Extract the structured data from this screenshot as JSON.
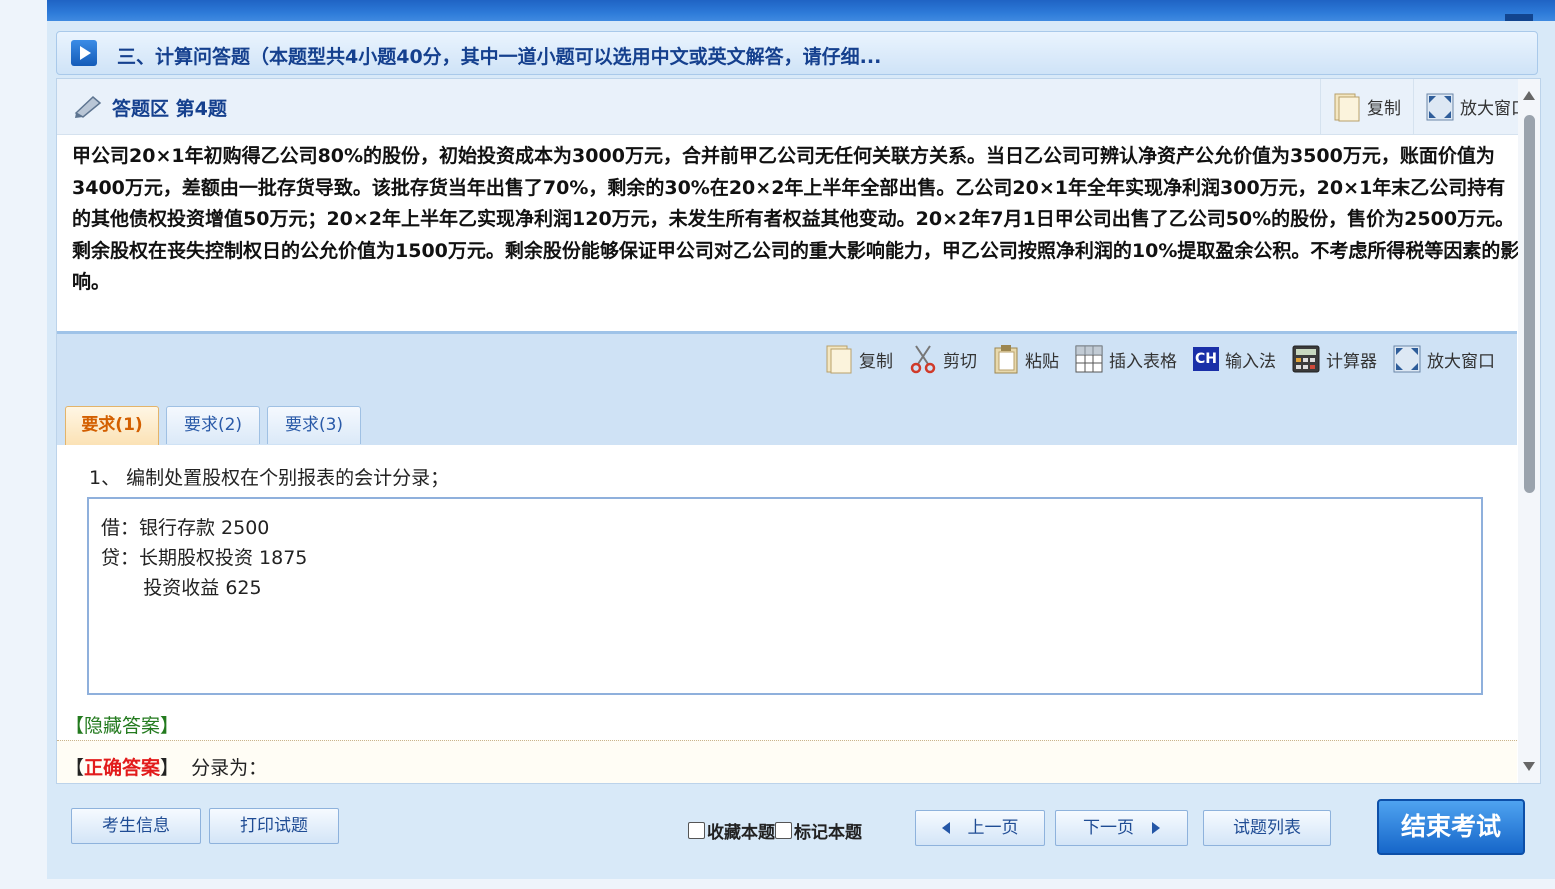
{
  "section": {
    "title": "三、计算问答题（本题型共4小题40分，其中一道小题可以选用中文或英文解答，请仔细..."
  },
  "question_header": {
    "title": "答题区 第4题",
    "copy_label": "复制",
    "enlarge_label": "放大窗口"
  },
  "question": {
    "text": "甲公司20×1年初购得乙公司80%的股份，初始投资成本为3000万元，合并前甲乙公司无任何关联方关系。当日乙公司可辨认净资产公允价值为3500万元，账面价值为3400万元，差额由一批存货导致。该批存货当年出售了70%，剩余的30%在20×2年上半年全部出售。乙公司20×1年全年实现净利润300万元，20×1年末乙公司持有的其他债权投资增值50万元；20×2年上半年乙实现净利润120万元，未发生所有者权益其他变动。20×2年7月1日甲公司出售了乙公司50%的股份，售价为2500万元。剩余股权在丧失控制权日的公允价值为1500万元。剩余股份能够保证甲公司对乙公司的重大影响能力，甲乙公司按照净利润的10%提取盈余公积。不考虑所得税等因素的影响。"
  },
  "editor_toolbar": {
    "copy": "复制",
    "cut": "剪切",
    "paste": "粘贴",
    "insert_table": "插入表格",
    "input_method": "输入法",
    "input_method_badge": "CH",
    "calculator": "计算器",
    "enlarge": "放大窗口"
  },
  "tabs": [
    {
      "label": "要求(1)",
      "active": true
    },
    {
      "label": "要求(2)",
      "active": false
    },
    {
      "label": "要求(3)",
      "active": false
    }
  ],
  "requirement": {
    "text": "1、 编制处置股权在个别报表的会计分录；"
  },
  "answer": {
    "lines": [
      "借：银行存款 2500",
      "贷：长期股权投资 1875",
      "       投资收益 625"
    ]
  },
  "hide_answer_label": "【隐藏答案】",
  "correct_answer": {
    "bracket_open": "【",
    "label": "正确答案",
    "bracket_close": "】",
    "text": "分录为："
  },
  "footer": {
    "candidate_info": "考生信息",
    "print_question": "打印试题",
    "bookmark_label": "收藏本题",
    "mark_label": "标记本题",
    "prev_page": "上一页",
    "next_page": "下一页",
    "question_list": "试题列表",
    "end_exam": "结束考试"
  },
  "colors": {
    "accent_blue": "#15408e",
    "correct_red": "#e21b1b",
    "hide_green": "#237a1e",
    "active_tab_orange": "#d35f00"
  }
}
